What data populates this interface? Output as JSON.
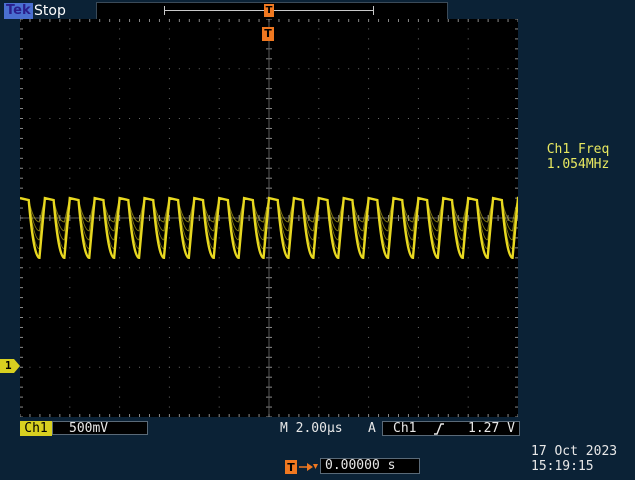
{
  "header": {
    "brand": "Tek",
    "run_state": "Stop"
  },
  "markers": {
    "trigger_marker": "T",
    "trigger_position_marker": "T",
    "ch1_ground_label": "1"
  },
  "measurement": {
    "label": "Ch1 Freq",
    "value": "1.054MHz"
  },
  "channel": {
    "name": "Ch1",
    "scale": "500mV"
  },
  "timebase": {
    "scale": "M 2.00µs"
  },
  "trigger": {
    "mode": "A",
    "source": "Ch1",
    "slope_icon": "rising-edge-icon",
    "level": "1.27 V"
  },
  "position": {
    "icon": "trigger-position-icon",
    "value": "0.00000 s"
  },
  "datetime": {
    "date": "17 Oct  2023",
    "time": "15:19:15"
  },
  "colors": {
    "trace": "#e8d820",
    "trigger": "#f07820",
    "background": "#0b2236"
  },
  "waveform": {
    "cycles": 20,
    "high_level_div": 0.4,
    "low_level_div": -0.8
  }
}
